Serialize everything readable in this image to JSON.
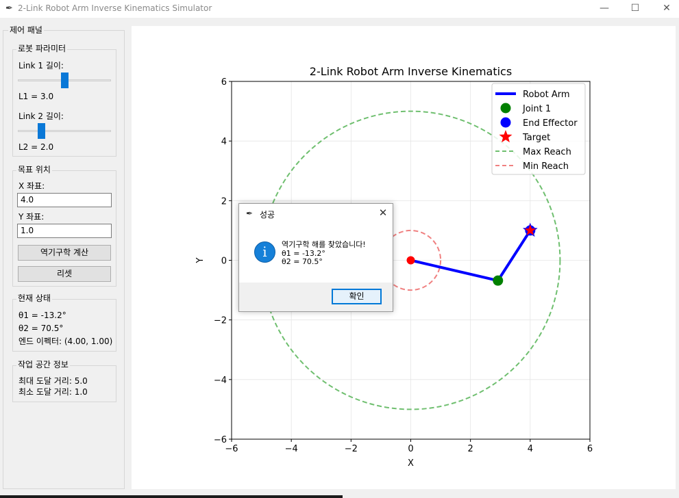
{
  "window": {
    "title": "2-Link Robot Arm Inverse Kinematics Simulator",
    "app_icon": "feather-icon",
    "controls": {
      "minimize": "—",
      "maximize": "☐",
      "close": "✕"
    }
  },
  "control_panel": {
    "title": "제어 패널",
    "robot_params": {
      "title": "로봇 파라미터",
      "link1_label": "Link 1 길이:",
      "link1_value_text": "L1 = 3.0",
      "link1_slider_fraction": 0.5,
      "link2_label": "Link 2 길이:",
      "link2_value_text": "L2 = 2.0",
      "link2_slider_fraction": 0.25
    },
    "target": {
      "title": "목표 위치",
      "x_label": "X 좌표:",
      "x_value": "4.0",
      "y_label": "Y 좌표:",
      "y_value": "1.0",
      "compute_button": "역기구학 계산",
      "reset_button": "리셋"
    },
    "status": {
      "title": "현재 상태",
      "theta1": "θ1 = -13.2°",
      "theta2": "θ2 = 70.5°",
      "end_effector": "엔드 이펙터: (4.00, 1.00)"
    },
    "workspace": {
      "title": "작업 공간 정보",
      "max_reach": "최대 도달 거리: 5.0",
      "min_reach": "최소 도달 거리: 1.0"
    }
  },
  "chart_data": {
    "type": "line",
    "title": "2-Link Robot Arm Inverse Kinematics",
    "xlabel": "X",
    "ylabel": "Y",
    "xlim": [
      -6,
      6
    ],
    "ylim": [
      -6,
      6
    ],
    "xticks": [
      -6,
      -4,
      -2,
      0,
      2,
      4,
      6
    ],
    "yticks": [
      -6,
      -4,
      -2,
      0,
      2,
      4,
      6
    ],
    "tick_labels": [
      "−6",
      "−4",
      "−2",
      "0",
      "2",
      "4",
      "6"
    ],
    "grid": true,
    "legend_position": "top-right",
    "series": [
      {
        "name": "Robot Arm",
        "kind": "line",
        "x": [
          0,
          2.92,
          4.0
        ],
        "y": [
          0,
          -0.68,
          1.0
        ],
        "color": "#0000ff"
      },
      {
        "name": "Joint 1",
        "kind": "point",
        "x": [
          2.92
        ],
        "y": [
          -0.68
        ],
        "color": "#008000"
      },
      {
        "name": "End Effector",
        "kind": "point",
        "x": [
          4.0
        ],
        "y": [
          1.0
        ],
        "color": "#0000ff"
      },
      {
        "name": "Target",
        "kind": "star",
        "x": [
          4.0
        ],
        "y": [
          1.0
        ],
        "color": "#ff0000"
      },
      {
        "name": "Max Reach",
        "kind": "circle",
        "radius": 5.0,
        "color": "#6fbf6f"
      },
      {
        "name": "Min Reach",
        "kind": "circle",
        "radius": 1.0,
        "color": "#f08080"
      }
    ],
    "base": {
      "x": 0,
      "y": 0,
      "color": "#ff0000"
    }
  },
  "dialog": {
    "title": "성공",
    "icon": "info-icon",
    "icon_glyph": "i",
    "message_line1": "역기구학 해를 찾았습니다!",
    "message_line2": "θ1 = -13.2°",
    "message_line3": "θ2 = 70.5°",
    "ok_button": "확인"
  }
}
